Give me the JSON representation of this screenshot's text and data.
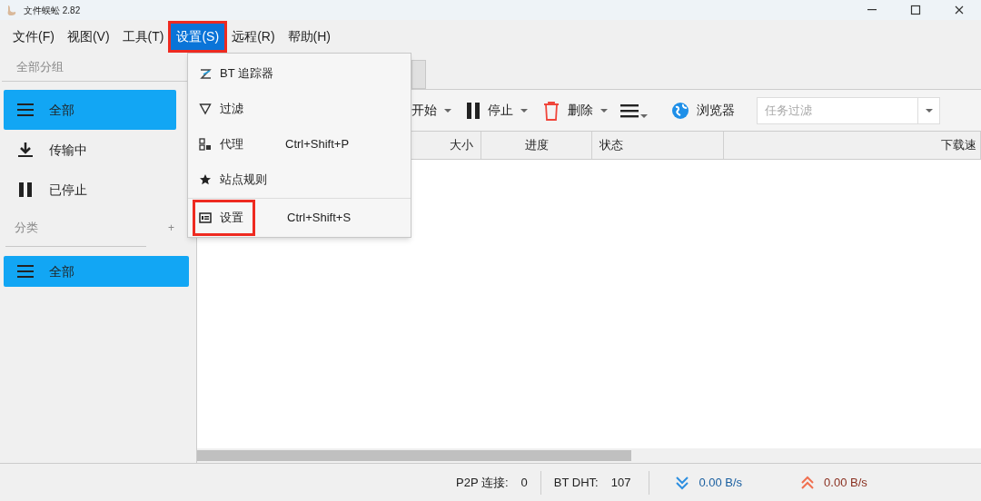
{
  "window": {
    "title": "文件蜈蚣 2.82"
  },
  "menu_bar": [
    {
      "label": "文件(F)",
      "selected": false,
      "highlighted": false
    },
    {
      "label": "视图(V)",
      "selected": false,
      "highlighted": false
    },
    {
      "label": "工具(T)",
      "selected": false,
      "highlighted": false
    },
    {
      "label": "设置(S)",
      "selected": true,
      "highlighted": true
    },
    {
      "label": "远程(R)",
      "selected": false,
      "highlighted": false
    },
    {
      "label": "帮助(H)",
      "selected": false,
      "highlighted": false
    }
  ],
  "dropdown": [
    {
      "kind": "tracker",
      "label": "BT 追踪器",
      "highlighted": false
    },
    {
      "kind": "filter",
      "label": "过滤",
      "highlighted": false
    },
    {
      "kind": "proxy",
      "label": "代理",
      "shortcut": "Ctrl+Shift+P",
      "highlighted": false
    },
    {
      "kind": "star",
      "label": "站点规则",
      "highlighted": false
    },
    {
      "kind": "settings",
      "label": "设置",
      "shortcut": "Ctrl+Shift+S",
      "highlighted": true
    }
  ],
  "sidebar": {
    "groups_header": "全部分组",
    "items": [
      {
        "kind": "list",
        "label": "全部",
        "selected": true
      },
      {
        "kind": "download",
        "label": "传输中",
        "selected": false
      },
      {
        "kind": "pause",
        "label": "已停止",
        "selected": false
      }
    ],
    "categories_header": "分类",
    "add": "+",
    "categories": [
      {
        "kind": "list",
        "label": "全部",
        "selected": true
      }
    ]
  },
  "toolbar": {
    "start": "开始",
    "stop": "停止",
    "delete": "删除",
    "browser": "浏览器",
    "filter_placeholder": "任务过滤"
  },
  "table": {
    "columns": [
      "大小",
      "进度",
      "状态",
      "下载速"
    ]
  },
  "status_bar": {
    "p2p_label": "P2P 连接:",
    "p2p": "0",
    "dht_label": "BT DHT:",
    "dht": "107",
    "down": "0.00 B/s",
    "up": "0.00 B/s"
  }
}
